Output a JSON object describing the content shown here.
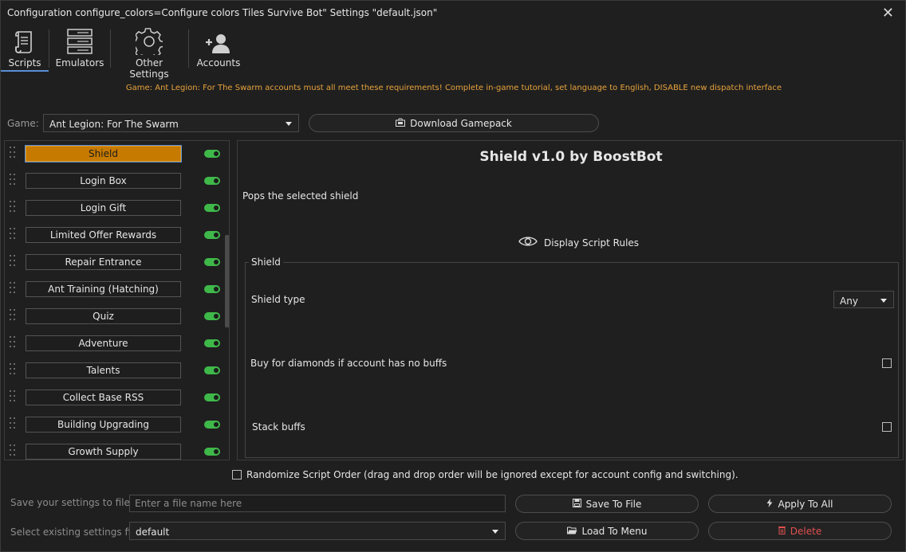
{
  "window": {
    "title": "Configuration configure_colors=Configure colors Tiles Survive Bot\" Settings \"default.json\"",
    "close_glyph": "✕"
  },
  "toolbar": {
    "items": [
      {
        "label": "Scripts",
        "icon": "scroll-icon",
        "active": true
      },
      {
        "label": "Emulators",
        "icon": "server-icon"
      },
      {
        "label": "Other Settings",
        "icon": "gear-icon"
      },
      {
        "label": "Accounts",
        "icon": "users-add-icon"
      }
    ]
  },
  "notice": "Game: Ant Legion: For The Swarm accounts must all meet these requirements! Complete in-game tutorial, set language to English, DISABLE new dispatch interface",
  "game": {
    "label": "Game:",
    "selected": "Ant Legion: For The Swarm",
    "download_label": "Download Gamepack"
  },
  "scripts": [
    {
      "label": "Shield",
      "enabled": true,
      "active": true
    },
    {
      "label": "Login Box",
      "enabled": true
    },
    {
      "label": "Login Gift",
      "enabled": true
    },
    {
      "label": "Limited Offer Rewards",
      "enabled": true
    },
    {
      "label": "Repair Entrance",
      "enabled": true
    },
    {
      "label": "Ant Training (Hatching)",
      "enabled": true
    },
    {
      "label": "Quiz",
      "enabled": true
    },
    {
      "label": "Adventure",
      "enabled": true
    },
    {
      "label": "Talents",
      "enabled": true
    },
    {
      "label": "Collect Base RSS",
      "enabled": true
    },
    {
      "label": "Building Upgrading",
      "enabled": true
    },
    {
      "label": "Growth Supply",
      "enabled": true
    }
  ],
  "detail": {
    "title": "Shield v1.0 by BoostBot",
    "description": "Pops the selected shield",
    "rules_label": "Display Script Rules",
    "group_title": "Shield",
    "shield_type_label": "Shield type",
    "shield_type_value": "Any",
    "buy_diamonds_label": "Buy for diamonds if account has no buffs",
    "stack_buffs_label": "Stack buffs"
  },
  "randomize": {
    "label": "Randomize Script Order (drag and drop order will be ignored except for account config and switching).",
    "checked": false
  },
  "footer": {
    "save_label": "Save your settings to file",
    "save_placeholder": "Enter a file name here",
    "save_button": "Save To File",
    "apply_button": "Apply To All",
    "select_label": "Select existing settings file",
    "select_value": "default",
    "load_button": "Load To Menu",
    "delete_button": "Delete"
  },
  "colors": {
    "accent": "#c77a00",
    "notice": "#e8a33c",
    "toggle_on": "#3fb84a",
    "delete": "#e05050",
    "tab_underline": "#5a8fd6"
  }
}
